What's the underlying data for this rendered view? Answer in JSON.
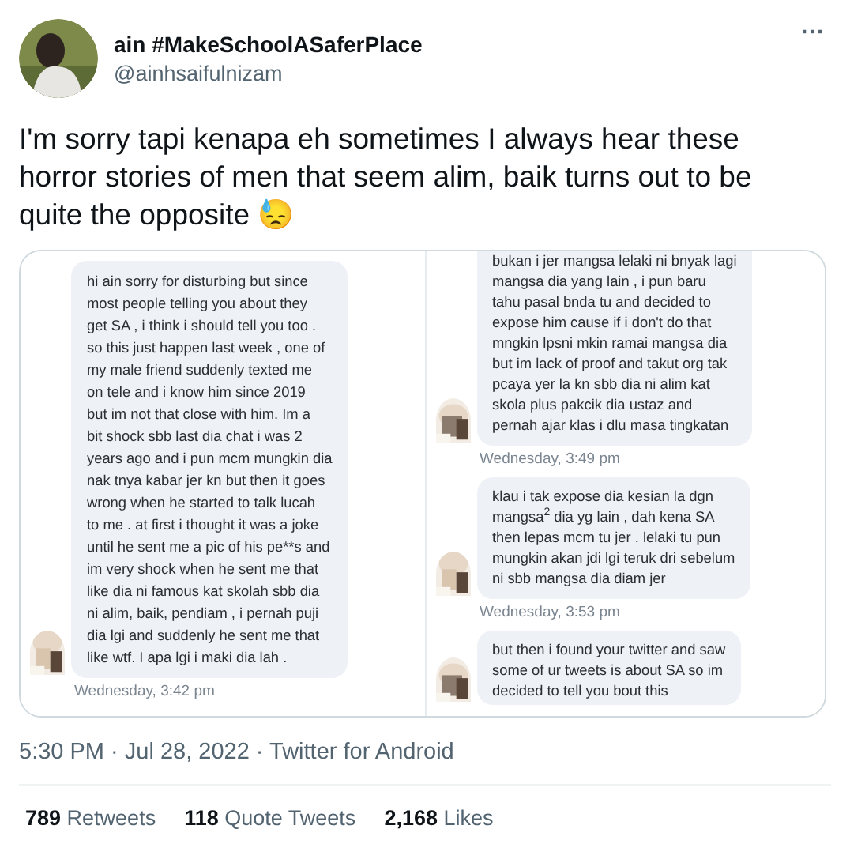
{
  "author": {
    "name": "ain #MakeSchoolASaferPlace",
    "handle": "@ainhsaifulnizam"
  },
  "more": "···",
  "text": "I'm sorry tapi kenapa eh sometimes I always hear these horror stories of men that seem alim, baik turns out to be quite the opposite 😓",
  "media": [
    {
      "messages": [
        {
          "text": "hi ain sorry for disturbing but since\nmost people telling you about they\nget SA , i think i should tell you too .\nso this just happen last week , one of\nmy male friend suddenly texted me\non tele and i know him since 2019\nbut im not that close with him. Im a\nbit shock sbb last dia chat i was 2\nyears ago and i pun mcm mungkin dia\nnak tnya kabar jer kn but then it goes\nwrong when he started to talk lucah\nto me . at first i thought it was a joke\nuntil he sent me a pic of his pe**s and\nim very shock when he sent me that\nlike dia ni famous kat skolah sbb dia\nni alim, baik, pendiam , i pernah puji\ndia lgi and suddenly he sent me that\nlike wtf. I apa lgi i maki dia lah .",
          "time": "Wednesday, 3:42 pm"
        }
      ]
    },
    {
      "messages": [
        {
          "text": "bukan i jer mangsa lelaki ni bnyak lagi\nmangsa dia yang lain , i pun baru\ntahu pasal bnda tu and decided to\nexpose him cause if i don't do that\nmngkin lpsni mkin ramai mangsa dia\nbut im lack of proof and takut org tak\npcaya yer la kn sbb dia ni alim kat\nskola plus pakcik dia ustaz and\npernah ajar klas i dlu masa tingkatan",
          "time": "Wednesday, 3:49 pm"
        },
        {
          "text": "klau i tak expose dia kesian la dgn\nmangsa$^{2}$ dia yg lain , dah kena SA\nthen lepas mcm tu jer . lelaki tu pun\nmungkin akan jdi lgi teruk dri sebelum\nni sbb mangsa dia diam jer",
          "time": "Wednesday, 3:53 pm"
        },
        {
          "text": "but then i found your twitter and saw\nsome of ur tweets is about SA so im\ndecided to tell you bout this"
        }
      ]
    }
  ],
  "meta": "5:30 PM · Jul 28, 2022 · Twitter for Android",
  "stats": [
    {
      "count": "789",
      "label": "Retweets"
    },
    {
      "count": "118",
      "label": "Quote Tweets"
    },
    {
      "count": "2,168",
      "label": "Likes"
    }
  ]
}
